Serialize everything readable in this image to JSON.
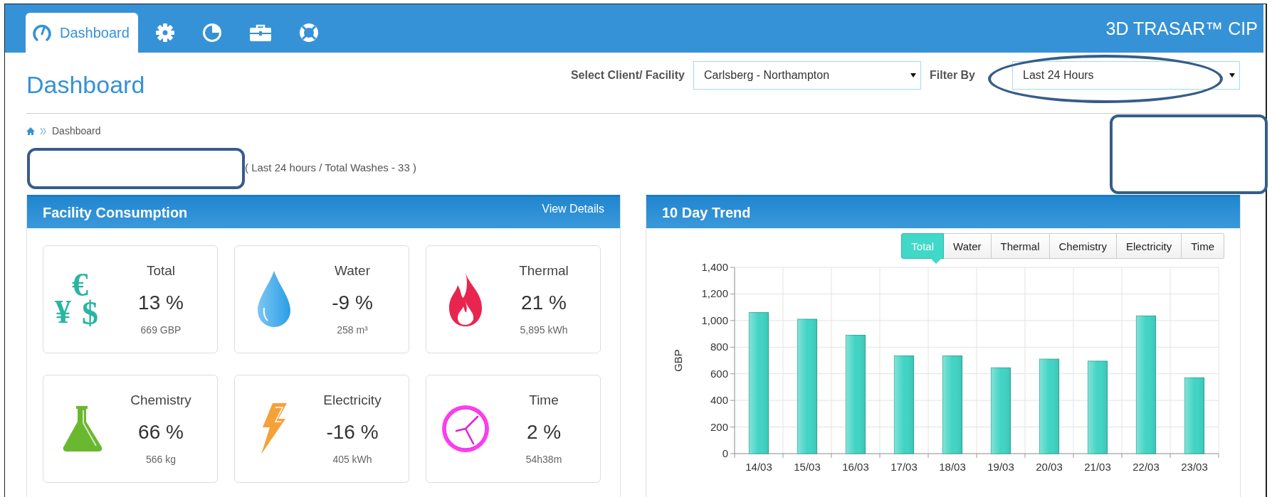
{
  "nav": {
    "tabs": [
      {
        "kind": "gauge",
        "label": "Dashboard",
        "selected": true
      },
      {
        "kind": "gear",
        "selected": false
      },
      {
        "kind": "pie",
        "selected": false
      },
      {
        "kind": "briefcase",
        "selected": false
      },
      {
        "kind": "lifebuoy",
        "selected": false
      }
    ],
    "brand": "3D TRASAR™ CIP"
  },
  "header": {
    "title": "Dashboard",
    "client_label": "Select Client/ Facility",
    "client_value": "Carlsberg - Northampton",
    "filter_label": "Filter By",
    "filter_value": "Last 24 Hours"
  },
  "breadcrumb": [
    "Dashboard"
  ],
  "summary": "( Last 24 hours / Total Washes - 33 )",
  "highlights": [
    {
      "kind": "box"
    },
    {
      "kind": "ellipse"
    },
    {
      "kind": "box"
    }
  ],
  "consumption": {
    "title": "Facility Consumption",
    "link": "View Details",
    "cards": [
      {
        "kind": "money",
        "icon_glyphs": [
          "€",
          "¥",
          "$"
        ],
        "label": "Total",
        "value": "13 %",
        "amount": "669 GBP"
      },
      {
        "kind": "water",
        "label": "Water",
        "value": "-9 %",
        "amount": "258 m³"
      },
      {
        "kind": "thermal",
        "label": "Thermal",
        "value": "21 %",
        "amount": "5,895 kWh"
      },
      {
        "kind": "chemistry",
        "label": "Chemistry",
        "value": "66 %",
        "amount": "566 kg"
      },
      {
        "kind": "electricity",
        "label": "Electricity",
        "value": "-16 %",
        "amount": "405 kWh"
      },
      {
        "kind": "time",
        "label": "Time",
        "value": "2 %",
        "amount": "54h38m"
      }
    ]
  },
  "trend": {
    "title": "10 Day Trend",
    "tabs": [
      {
        "label": "Total",
        "selected": true
      },
      {
        "label": "Water",
        "selected": false
      },
      {
        "label": "Thermal",
        "selected": false
      },
      {
        "label": "Chemistry",
        "selected": false
      },
      {
        "label": "Electricity",
        "selected": false
      },
      {
        "label": "Time",
        "selected": false
      }
    ],
    "chart_data": {
      "type": "bar",
      "ylabel": "GBP",
      "categories": [
        "14/03",
        "15/03",
        "16/03",
        "17/03",
        "18/03",
        "19/03",
        "20/03",
        "21/03",
        "22/03",
        "23/03"
      ],
      "series": [
        {
          "color": "#40d4c4",
          "values": [
            1060,
            1010,
            890,
            735,
            735,
            645,
            710,
            695,
            1035,
            570
          ]
        }
      ],
      "ylim": [
        0,
        1400
      ],
      "grid": true,
      "yticks": [
        0,
        200,
        400,
        600,
        800,
        {
          "value": 1000,
          "label": "1,000"
        },
        {
          "value": 1200,
          "label": "1,200"
        },
        {
          "value": 1400,
          "label": "1,400"
        }
      ]
    }
  }
}
